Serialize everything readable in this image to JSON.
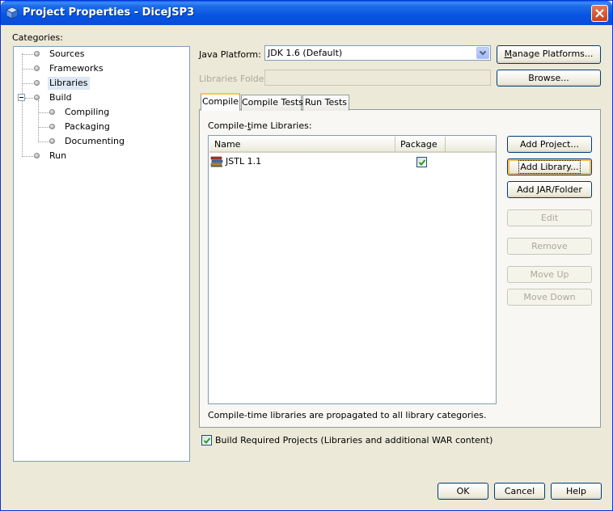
{
  "window": {
    "title": "Project Properties - DiceJSP3",
    "brand_color": "#0854e3"
  },
  "categories": {
    "label": "Categories:",
    "items": [
      {
        "label": "Sources",
        "level": 1
      },
      {
        "label": "Frameworks",
        "level": 1
      },
      {
        "label": "Libraries",
        "level": 1,
        "selected": true
      },
      {
        "label": "Build",
        "level": 1,
        "expanded": true
      },
      {
        "label": "Compiling",
        "level": 2
      },
      {
        "label": "Packaging",
        "level": 2
      },
      {
        "label": "Documenting",
        "level": 2
      },
      {
        "label": "Run",
        "level": 1
      }
    ]
  },
  "platform": {
    "label_prefix": "",
    "label_mnemonic": "J",
    "label_rest": "ava Platform:",
    "value": "JDK 1.6 (Default)",
    "manage_prefix": "",
    "manage_mnemonic": "M",
    "manage_rest": "anage Platforms..."
  },
  "libraries_folder": {
    "label": "Libraries Folder:",
    "value": "",
    "browse_label": "Browse..."
  },
  "tabs": [
    {
      "label": "Compile",
      "active": true
    },
    {
      "label": "Compile Tests",
      "active": false
    },
    {
      "label": "Run Tests",
      "active": false
    }
  ],
  "compile": {
    "libraries_label_pre": "Compile-",
    "libraries_label_mnemonic": "t",
    "libraries_label_rest": "ime Libraries:",
    "columns": [
      "Name",
      "Package"
    ],
    "rows": [
      {
        "name": "JSTL 1.1",
        "package": true
      }
    ],
    "note": "Compile-time libraries are propagated to all library categories."
  },
  "side_buttons": {
    "add_project": "Add Project...",
    "add_library": "Add Library...",
    "add_jar": "Add JAR/Folder",
    "edit": "Edit",
    "remove": "Remove",
    "move_up": "Move Up",
    "move_down": "Move Down"
  },
  "build_required": {
    "checked": true,
    "label": "Build Required Projects (Libraries and additional WAR content)"
  },
  "footer": {
    "ok": "OK",
    "cancel": "Cancel",
    "help": "Help"
  }
}
